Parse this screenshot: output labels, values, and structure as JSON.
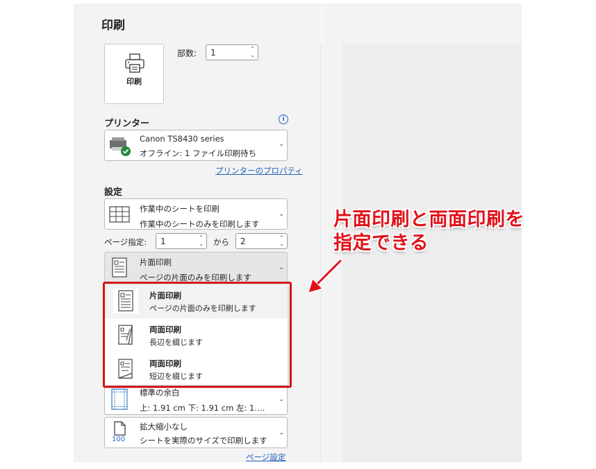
{
  "title": "印刷",
  "print_button": {
    "label": "印刷",
    "icon": "printer-icon"
  },
  "copies": {
    "label": "部数:",
    "value": "1"
  },
  "printer": {
    "section": "プリンター",
    "name": "Canon TS8430 series",
    "status": "オフライン: 1 ファイル印刷待ち",
    "properties_link": "プリンターのプロパティ",
    "info_icon": "i"
  },
  "settings": {
    "section": "設定",
    "scope": {
      "line1": "作業中のシートを印刷",
      "line2": "作業中のシートのみを印刷します"
    },
    "pages": {
      "label": "ページ指定:",
      "from": "1",
      "to_label": "から",
      "to": "2"
    },
    "sides": {
      "line1": "片面印刷",
      "line2": "ページの片面のみを印刷します"
    },
    "margins": {
      "line1": "標準の余白",
      "line2": "上: 1.91 cm 下: 1.91 cm 左: 1.…"
    },
    "scaling": {
      "line1": "拡大縮小なし",
      "line2": "シートを実際のサイズで印刷します",
      "icon_text": "100"
    },
    "page_setup_link": "ページ設定"
  },
  "sides_menu": [
    {
      "title": "片面印刷",
      "desc": "ページの片面のみを印刷します",
      "icon": "single-sided-icon",
      "selected": true
    },
    {
      "title": "両面印刷",
      "desc": "長辺を綴じます",
      "icon": "duplex-long-edge-icon",
      "selected": false
    },
    {
      "title": "両面印刷",
      "desc": "短辺を綴じます",
      "icon": "duplex-short-edge-icon",
      "selected": false
    }
  ],
  "annotation": {
    "line1": "片面印刷と両面印刷を",
    "line2": "指定できる",
    "color": "#e0121a"
  },
  "colors": {
    "accent_link": "#1f62b8",
    "highlight_frame": "#d4141a",
    "panel_bg": "#f3f3f3"
  }
}
